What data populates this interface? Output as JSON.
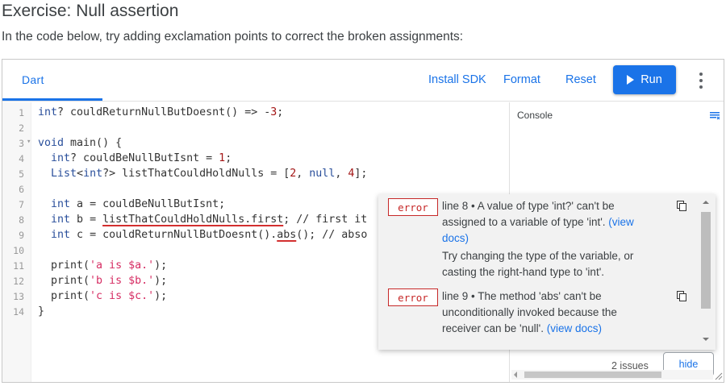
{
  "exercise": {
    "title": "Exercise: Null assertion",
    "description": "In the code below, try adding exclamation points to correct the broken assignments:"
  },
  "toolbar": {
    "tab_label": "Dart",
    "install_sdk": "Install SDK",
    "format": "Format",
    "reset": "Reset",
    "run": "Run",
    "more_icon": "more-vert-icon"
  },
  "editor": {
    "line_numbers": [
      "1",
      "2",
      "3",
      "4",
      "5",
      "6",
      "7",
      "8",
      "9",
      "10",
      "11",
      "12",
      "13",
      "14"
    ],
    "fold_marker": "▾",
    "copy_icon": "copy-icon"
  },
  "console": {
    "label": "Console",
    "clear_icon": "clear-console-icon"
  },
  "issues": [
    {
      "badge": "error",
      "message": "line 8 • A value of type 'int?' can't be assigned to a variable of type 'int'.",
      "link": "(view docs)",
      "hint": "Try changing the type of the variable, or casting the right-hand type to 'int'."
    },
    {
      "badge": "error",
      "message": "line 9 • The method 'abs' can't be unconditionally invoked because the receiver can be 'null'.",
      "link": "(view docs)",
      "hint": ""
    }
  ],
  "footer": {
    "issues_count": "2 issues",
    "hide": "hide"
  },
  "colors": {
    "accent": "#1a73e8",
    "error": "#c62828",
    "code_type": "#2a4f9b",
    "code_string": "#d62d63"
  }
}
